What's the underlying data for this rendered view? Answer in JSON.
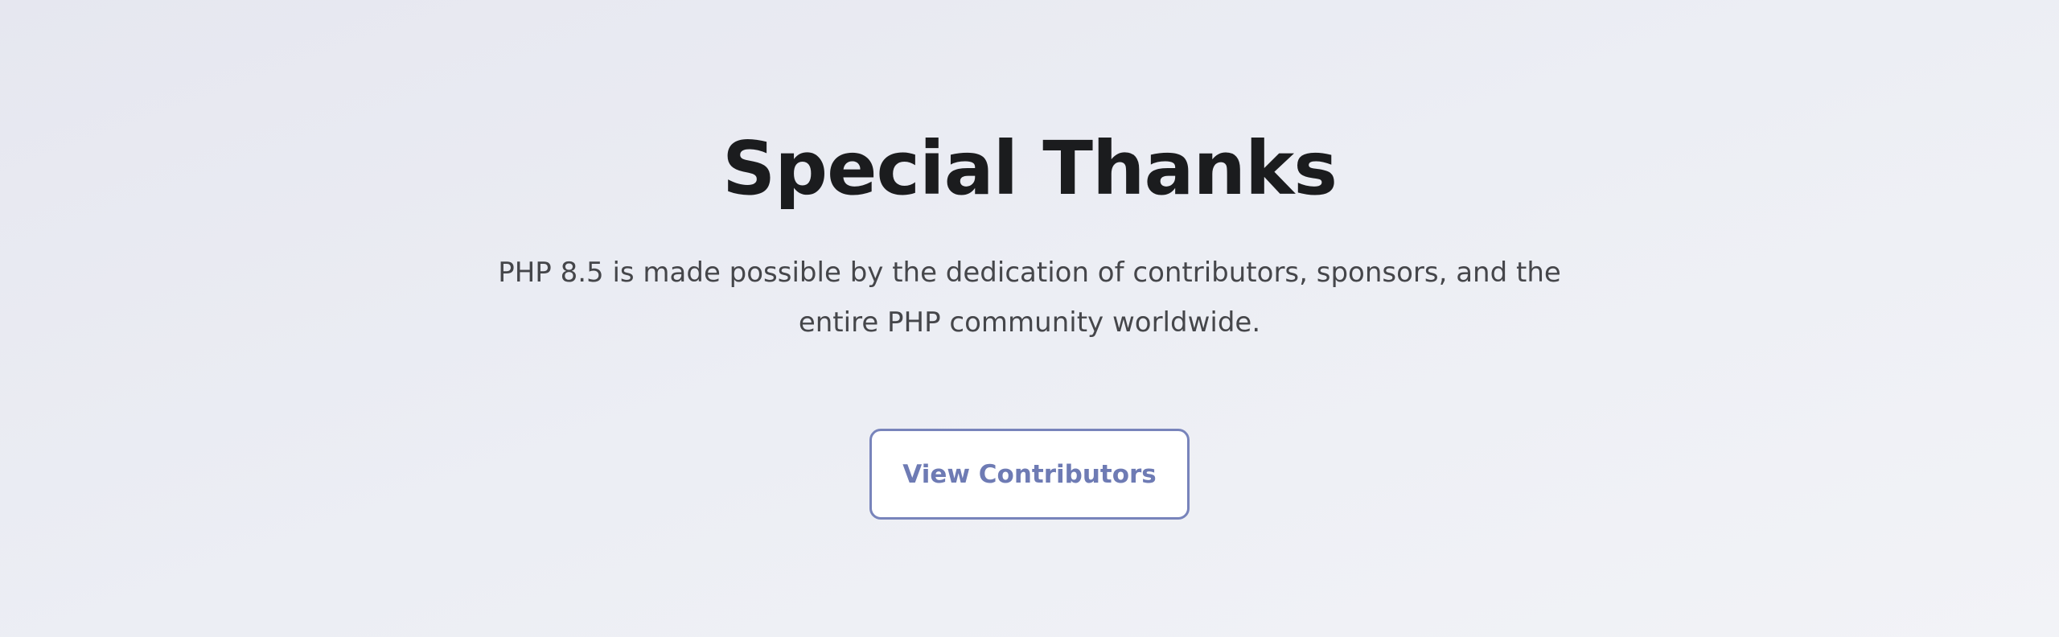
{
  "thanks_section": {
    "title": "Special Thanks",
    "description": "PHP 8.5 is made possible by the dedication of contributors, sponsors, and the entire PHP community worldwide.",
    "button_label": "View Contributors"
  },
  "colors": {
    "accent": "#7884bb",
    "title_text": "#1b1c1e",
    "body_text": "#45464a",
    "background": "#eceef4"
  }
}
